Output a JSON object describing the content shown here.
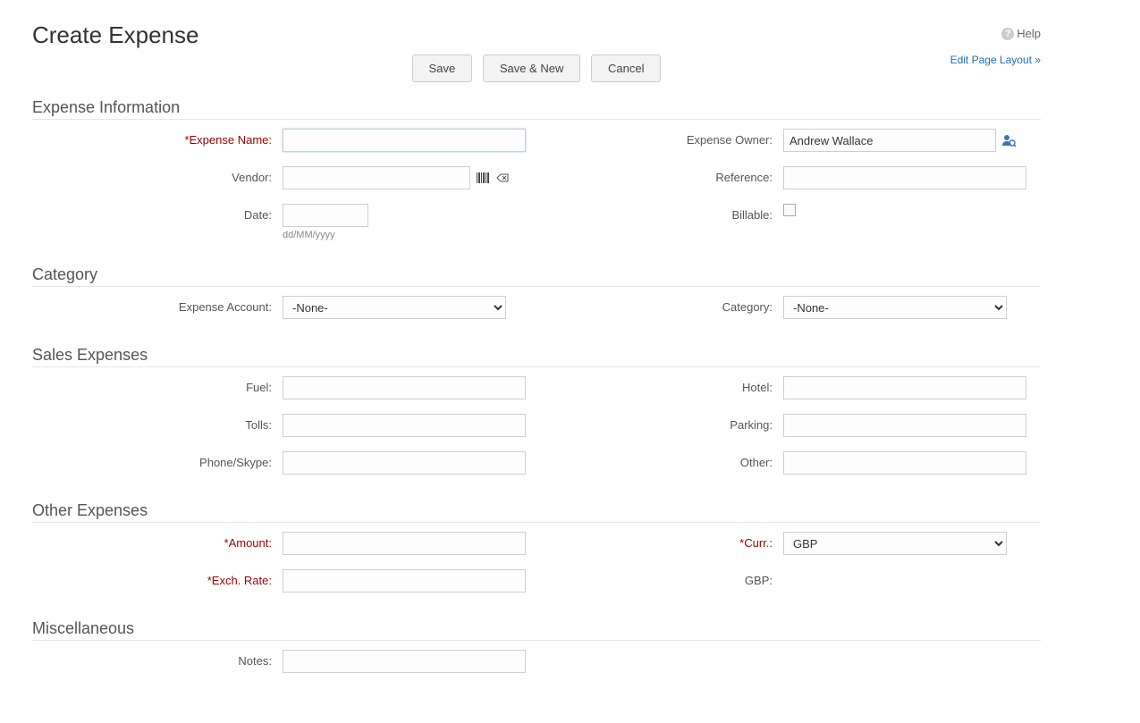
{
  "header": {
    "title": "Create Expense",
    "help_label": "Help",
    "edit_layout_label": "Edit Page Layout »"
  },
  "buttons": {
    "save": "Save",
    "save_new": "Save & New",
    "cancel": "Cancel"
  },
  "sections": {
    "expense_info": "Expense Information",
    "category": "Category",
    "sales_expenses": "Sales Expenses",
    "other_expenses": "Other Expenses",
    "miscellaneous": "Miscellaneous"
  },
  "labels": {
    "expense_name": "*Expense Name:",
    "vendor": "Vendor:",
    "date": "Date:",
    "date_hint": "dd/MM/yyyy",
    "expense_owner": "Expense Owner:",
    "reference": "Reference:",
    "billable": "Billable:",
    "expense_account": "Expense Account:",
    "category_label": "Category:",
    "fuel": "Fuel:",
    "tolls": "Tolls:",
    "phone_skype": "Phone/Skype:",
    "hotel": "Hotel:",
    "parking": "Parking:",
    "other": "Other:",
    "amount": "*Amount:",
    "exch_rate": "*Exch. Rate:",
    "curr": "*Curr.:",
    "gbp": "GBP:",
    "notes": "Notes:"
  },
  "values": {
    "expense_name": "",
    "vendor": "",
    "date": "",
    "expense_owner": "Andrew Wallace",
    "reference": "",
    "billable": false,
    "expense_account": "-None-",
    "category": "-None-",
    "fuel": "",
    "tolls": "",
    "phone_skype": "",
    "hotel": "",
    "parking": "",
    "other": "",
    "amount": "",
    "exch_rate": "",
    "curr": "GBP",
    "gbp": "",
    "notes": ""
  }
}
